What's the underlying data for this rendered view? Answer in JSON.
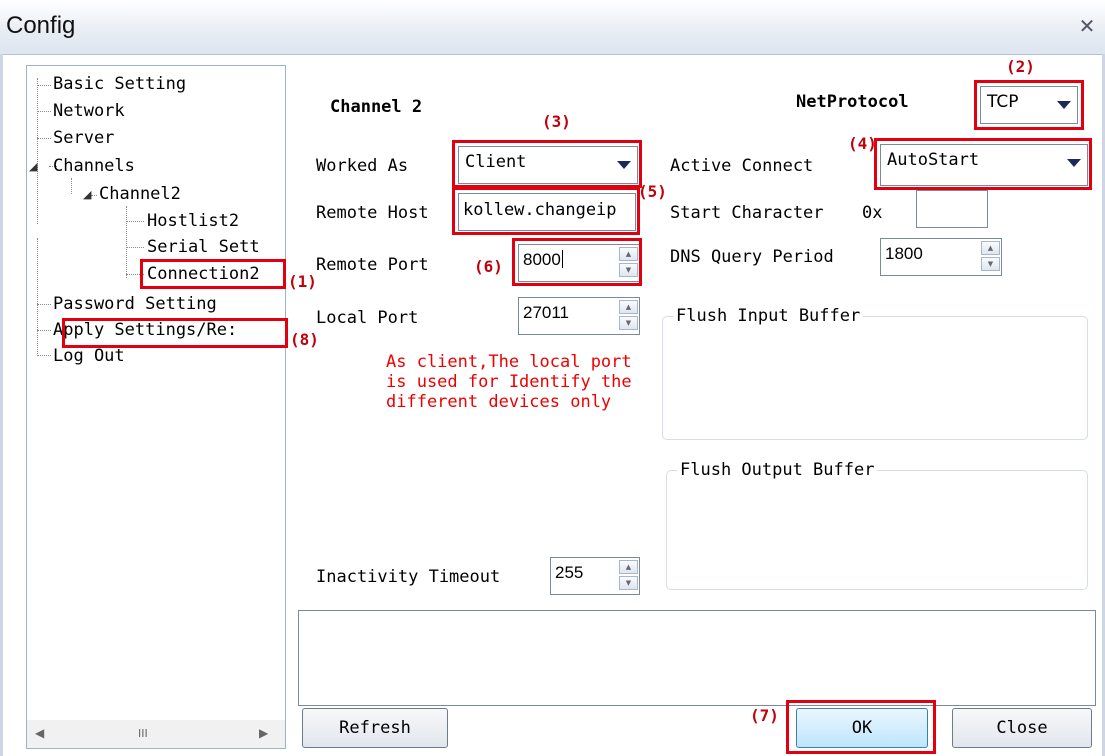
{
  "window": {
    "title": "Config",
    "close_glyph": "✕"
  },
  "tree": {
    "items": [
      {
        "label": "Basic Setting"
      },
      {
        "label": "Network"
      },
      {
        "label": "Server"
      },
      {
        "label": "Channels"
      },
      {
        "label": "Channel2"
      },
      {
        "label": "Hostlist2"
      },
      {
        "label": "Serial Sett"
      },
      {
        "label": "Connection2"
      },
      {
        "label": "Password Setting"
      },
      {
        "label": "Apply Settings/Re:"
      },
      {
        "label": "Log Out"
      }
    ],
    "scroll_grip": "III"
  },
  "form": {
    "channel_title": "Channel 2",
    "net_protocol": {
      "label": "NetProtocol",
      "value": "TCP"
    },
    "worked_as": {
      "label": "Worked As",
      "value": "Client"
    },
    "active_connect": {
      "label": "Active Connect",
      "value": "AutoStart"
    },
    "remote_host": {
      "label": "Remote Host",
      "value": "kollew.changeip"
    },
    "start_character": {
      "label": "Start Character",
      "prefix": "0x",
      "value": ""
    },
    "remote_port": {
      "label": "Remote Port",
      "value": "8000"
    },
    "dns_query_period": {
      "label": "DNS Query Period",
      "value": "1800"
    },
    "local_port": {
      "label": "Local Port",
      "value": "27011"
    },
    "flush_input_buffer": {
      "label": "Flush Input Buffer"
    },
    "flush_output_buffer": {
      "label": "Flush Output Buffer"
    },
    "note": "As client,The local port\nis used for Identify the\ndifferent devices only",
    "inactivity_timeout": {
      "label": "Inactivity Timeout",
      "value": "255"
    }
  },
  "buttons": {
    "refresh": "Refresh",
    "ok": "OK",
    "close": "Close"
  },
  "markers": {
    "m1": "(1)",
    "m2": "(2)",
    "m3": "(3)",
    "m4": "(4)",
    "m5": "(5)",
    "m6": "(6)",
    "m7": "(7)",
    "m8": "(8)"
  },
  "colors": {
    "annotation_red": "#e00010",
    "note_red": "#ee0000"
  },
  "icons": [
    "close-icon",
    "dropdown-arrow-icon",
    "spin-up-icon",
    "spin-down-icon",
    "scroll-left-icon",
    "scroll-right-icon",
    "tree-expand-icon"
  ]
}
